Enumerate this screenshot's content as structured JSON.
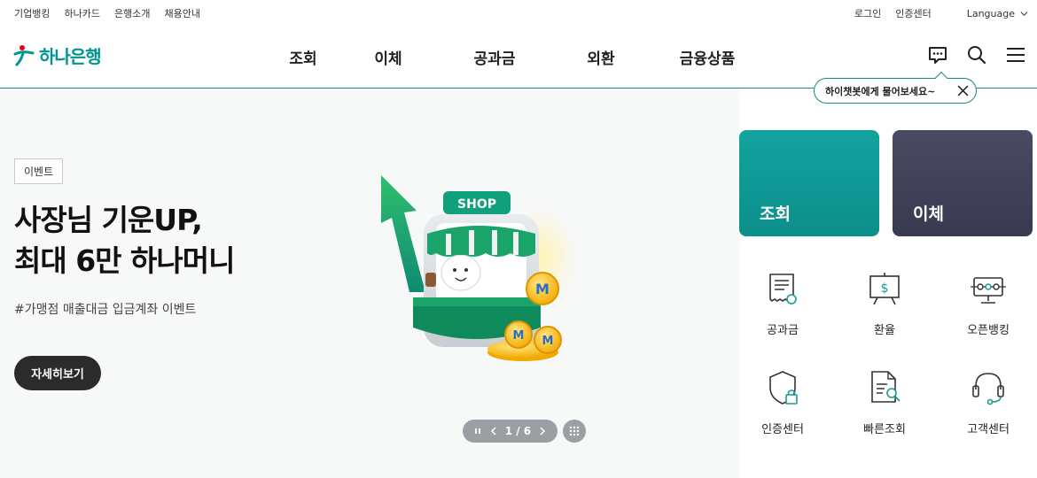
{
  "util": {
    "left_links": [
      "기업뱅킹",
      "하나카드",
      "은행소개",
      "채용안내"
    ],
    "login": "로그인",
    "cert_center": "인증센터",
    "language": "Language"
  },
  "header": {
    "logo_text": "하나은행",
    "nav": [
      "조회",
      "이체",
      "공과금",
      "외환",
      "금융상품"
    ]
  },
  "chatbot_tooltip": "하이챗봇에게 물어보세요~",
  "hero": {
    "badge": "이벤트",
    "title_line1": "사장님 기운UP,",
    "title_line2": "최대 6만 하나머니",
    "subtitle": "#가맹점 매출대금 입금계좌 이벤트",
    "button": "자세히보기",
    "illust_sign": "SHOP",
    "coin_letter": "M",
    "pager_text": "1 / 6"
  },
  "quick": {
    "tile_inquiry": "조회",
    "tile_transfer": "이체",
    "items": [
      "공과금",
      "환율",
      "오픈뱅킹",
      "인증센터",
      "빠른조회",
      "고객센터"
    ]
  },
  "colors": {
    "brand": "#009591",
    "tile_inquiry": "#0f9a96",
    "tile_transfer": "#3d3f55",
    "dark_button": "#2b2b2b"
  }
}
